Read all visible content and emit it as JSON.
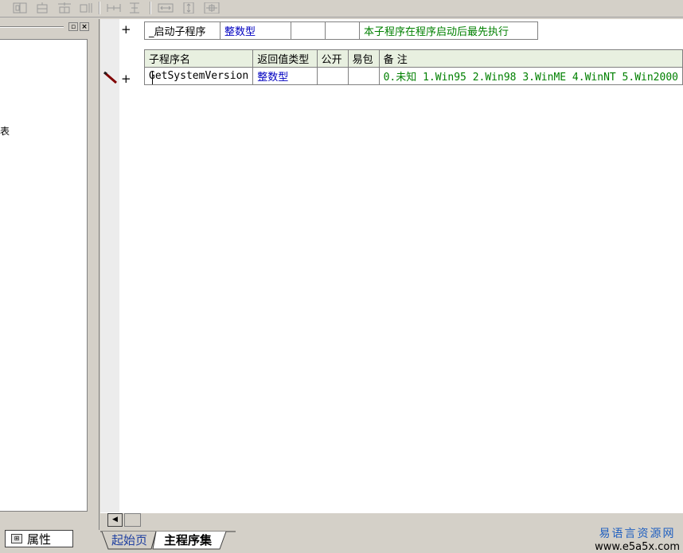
{
  "toolbar": {
    "icons": [
      "align-left-icon",
      "align-center-icon",
      "align-top-icon",
      "align-right-icon",
      "equal-width-icon",
      "equal-height-icon",
      "h-space-icon",
      "v-space-icon",
      "center-icon"
    ]
  },
  "left_panel": {
    "partial_char": "表",
    "properties_tab": "属性"
  },
  "code": {
    "startup_row": {
      "plus": "+",
      "name": "_启动子程序",
      "return_type": "整数型",
      "public": "",
      "pack": "",
      "comment": "本子程序在程序启动后最先执行"
    },
    "table_headers": [
      "子程序名",
      "返回值类型",
      "公开",
      "易包",
      "备 注"
    ],
    "sub_row": {
      "plus": "+",
      "name": "GetSystemVersion",
      "return_type": "整数型",
      "public": "",
      "pack": "",
      "comment": "0.未知 1.Win95 2.Win98 3.WinME 4.WinNT 5.Win2000"
    }
  },
  "tabs": {
    "start_page": "起始页",
    "main_procs": "主程序集"
  },
  "watermark": {
    "line1": "易语言资源网",
    "line2": "www.e5a5x.com"
  },
  "colors": {
    "keyword": "#0000c0",
    "comment": "#008000",
    "header_bg": "#e8f0e0"
  }
}
